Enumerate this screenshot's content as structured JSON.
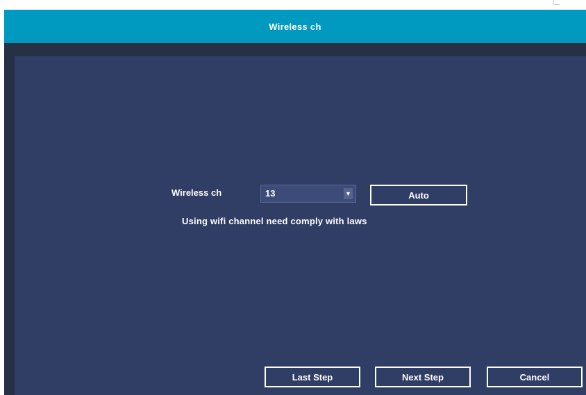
{
  "window": {
    "title": "Wireless ch"
  },
  "form": {
    "channel_label": "Wireless ch",
    "channel_value": "13",
    "dropdown_icon": "chevron-down-icon",
    "auto_label": "Auto",
    "notice": "Using wifi channel need comply with laws"
  },
  "footer": {
    "last_step_label": "Last Step",
    "next_step_label": "Next Step",
    "cancel_label": "Cancel"
  },
  "colors": {
    "title_bar": "#0099c0",
    "background": "#263146",
    "panel": "#303d65",
    "text": "#ffffff"
  }
}
